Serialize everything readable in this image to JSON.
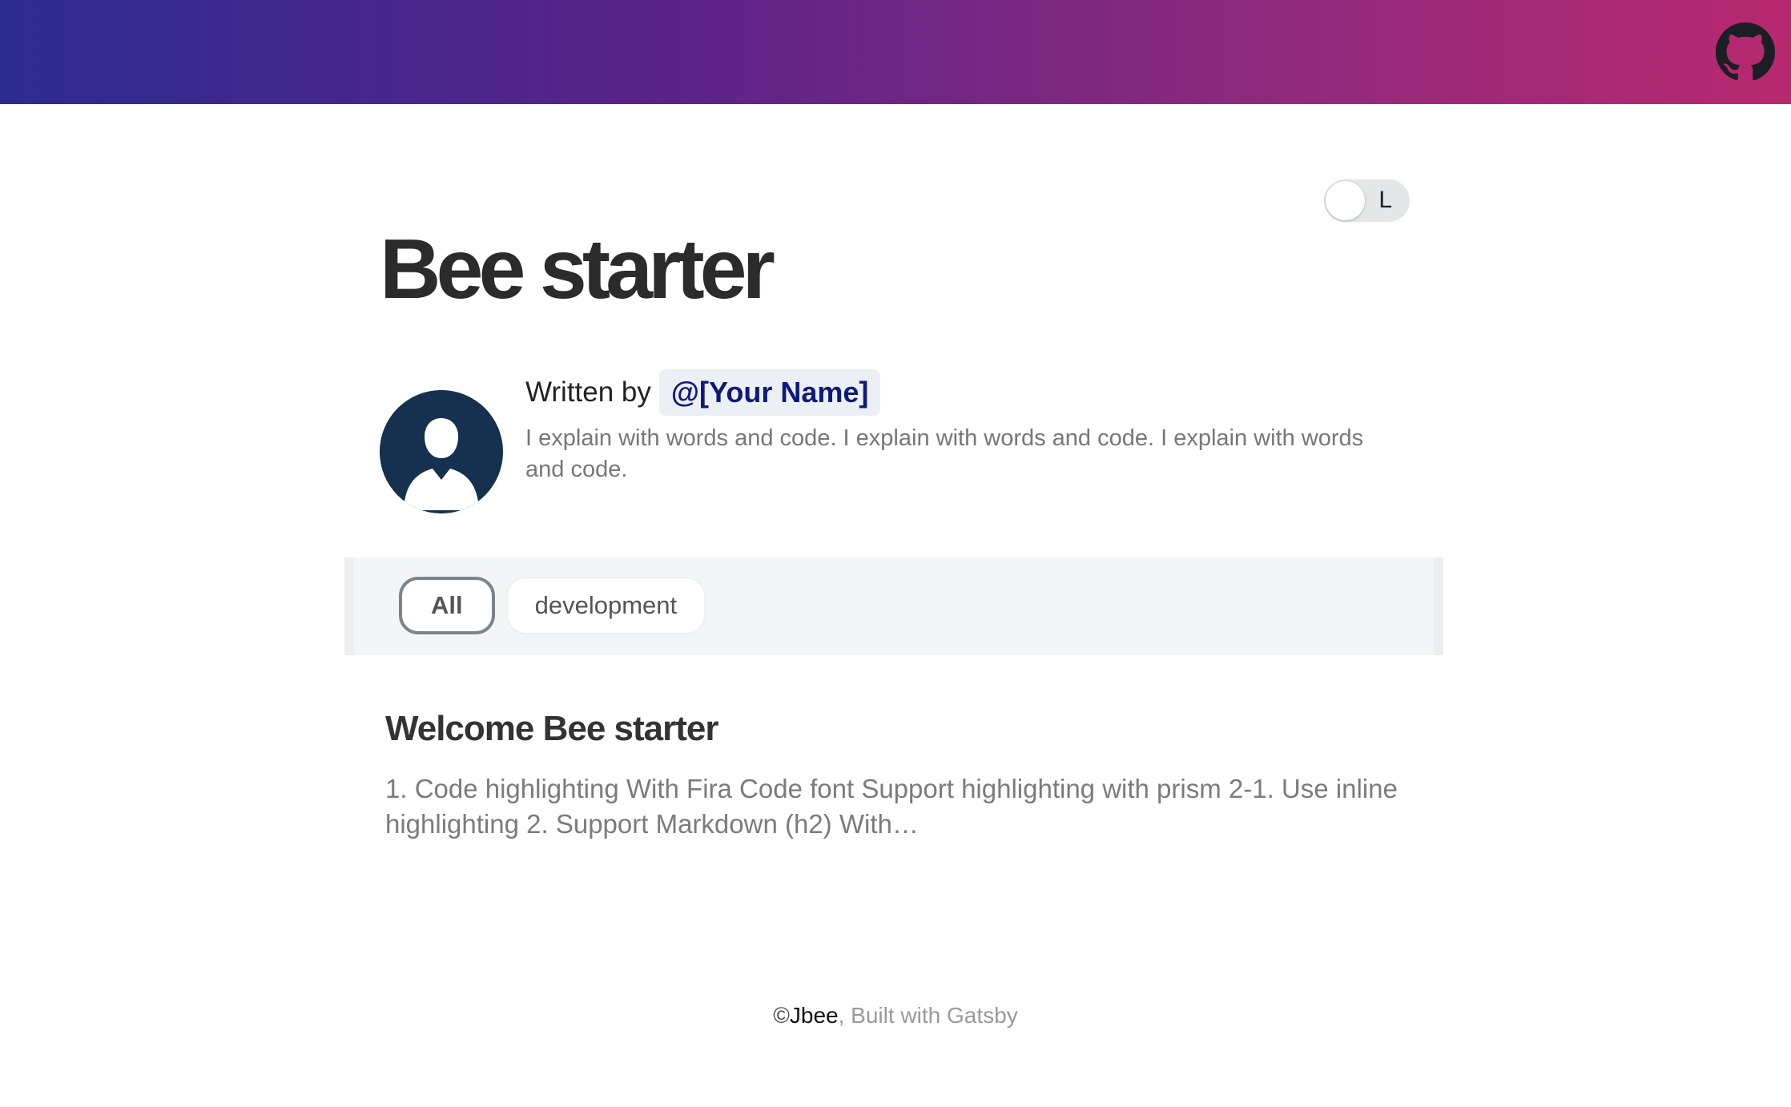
{
  "header": {
    "github_icon": "github-icon",
    "gradient": [
      "#2d2b8f",
      "#5b2388",
      "#8d2a7d",
      "#b8286f"
    ]
  },
  "theme_toggle": {
    "label": "L"
  },
  "blog": {
    "title": "Bee starter"
  },
  "bio": {
    "avatar_icon": "user-avatar-icon",
    "written_by": "Written by",
    "author": "@[Your Name]",
    "description": "I explain with words and code. I explain with words and code. I explain with words and code."
  },
  "categories": {
    "items": [
      {
        "label": "All",
        "active": true
      },
      {
        "label": "development",
        "active": false
      }
    ]
  },
  "posts": [
    {
      "title": "Welcome Bee starter",
      "excerpt": "1. Code highlighting With Fira Code font Support highlighting with prism 2-1. Use inline highlighting 2. Support Markdown (h2) With…"
    }
  ],
  "footer": {
    "copyright": "©",
    "owner": "Jbee",
    "built_with": ", Built with Gatsby"
  },
  "colors": {
    "author_bg": "#ecf0f4",
    "author_text": "#0e1a7a",
    "avatar_bg": "#16304f"
  }
}
